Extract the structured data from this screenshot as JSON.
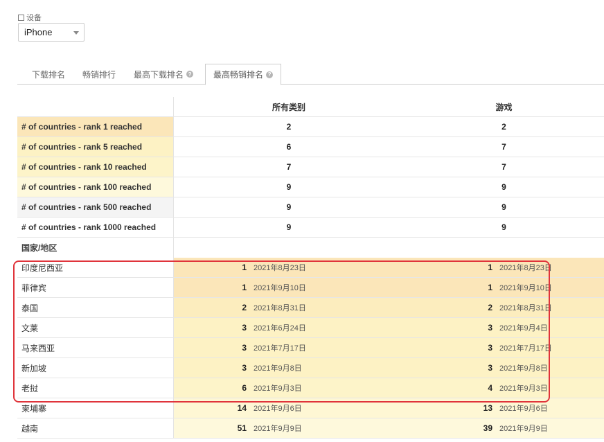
{
  "device": {
    "label": "设备",
    "selected": "iPhone"
  },
  "tabs": [
    {
      "label": "下载排名",
      "help": false
    },
    {
      "label": "畅销排行",
      "help": false
    },
    {
      "label": "最高下载排名",
      "help": true
    },
    {
      "label": "最高畅销排名",
      "help": true,
      "active": true
    }
  ],
  "table": {
    "columns": [
      "所有类别",
      "游戏"
    ],
    "stats": [
      {
        "label": "# of countries - rank 1 reached",
        "all": "2",
        "games": "2",
        "bg": "#fbe6b9"
      },
      {
        "label": "# of countries - rank 5 reached",
        "all": "6",
        "games": "7",
        "bg": "#fdf2c4"
      },
      {
        "label": "# of countries - rank 10 reached",
        "all": "7",
        "games": "7",
        "bg": "#fdf4c9"
      },
      {
        "label": "# of countries - rank 100 reached",
        "all": "9",
        "games": "9",
        "bg": "#fef9dc"
      },
      {
        "label": "# of countries - rank 500 reached",
        "all": "9",
        "games": "9",
        "bg": "#f4f4f4"
      },
      {
        "label": "# of countries - rank 1000 reached",
        "all": "9",
        "games": "9",
        "bg": "#ffffff"
      }
    ],
    "section_label": "国家/地区",
    "countries": [
      {
        "name": "印度尼西亚",
        "all_rank": "1",
        "all_date": "2021年8月23日",
        "games_rank": "1",
        "games_date": "2021年8月23日",
        "bg": "#fbe6b9"
      },
      {
        "name": "菲律宾",
        "all_rank": "1",
        "all_date": "2021年9月10日",
        "games_rank": "1",
        "games_date": "2021年9月10日",
        "bg": "#fbe6b9"
      },
      {
        "name": "泰国",
        "all_rank": "2",
        "all_date": "2021年8月31日",
        "games_rank": "2",
        "games_date": "2021年8月31日",
        "bg": "#fcedbe"
      },
      {
        "name": "文莱",
        "all_rank": "3",
        "all_date": "2021年6月24日",
        "games_rank": "3",
        "games_date": "2021年9月4日",
        "bg": "#fdf2c4"
      },
      {
        "name": "马来西亚",
        "all_rank": "3",
        "all_date": "2021年7月17日",
        "games_rank": "3",
        "games_date": "2021年7月17日",
        "bg": "#fdf2c4"
      },
      {
        "name": "新加坡",
        "all_rank": "3",
        "all_date": "2021年9月8日",
        "games_rank": "3",
        "games_date": "2021年9月8日",
        "bg": "#fdf2c4"
      },
      {
        "name": "老挝",
        "all_rank": "6",
        "all_date": "2021年9月3日",
        "games_rank": "4",
        "games_date": "2021年9月3日",
        "bg": "#fdf4c9"
      },
      {
        "name": "柬埔寨",
        "all_rank": "14",
        "all_date": "2021年9月6日",
        "games_rank": "13",
        "games_date": "2021年9月6日",
        "bg": "#fef7d4"
      },
      {
        "name": "越南",
        "all_rank": "51",
        "all_date": "2021年9月9日",
        "games_rank": "39",
        "games_date": "2021年9月9日",
        "bg": "#fef9dc"
      }
    ]
  },
  "colors": {
    "highlight_border": "#e0343b"
  }
}
